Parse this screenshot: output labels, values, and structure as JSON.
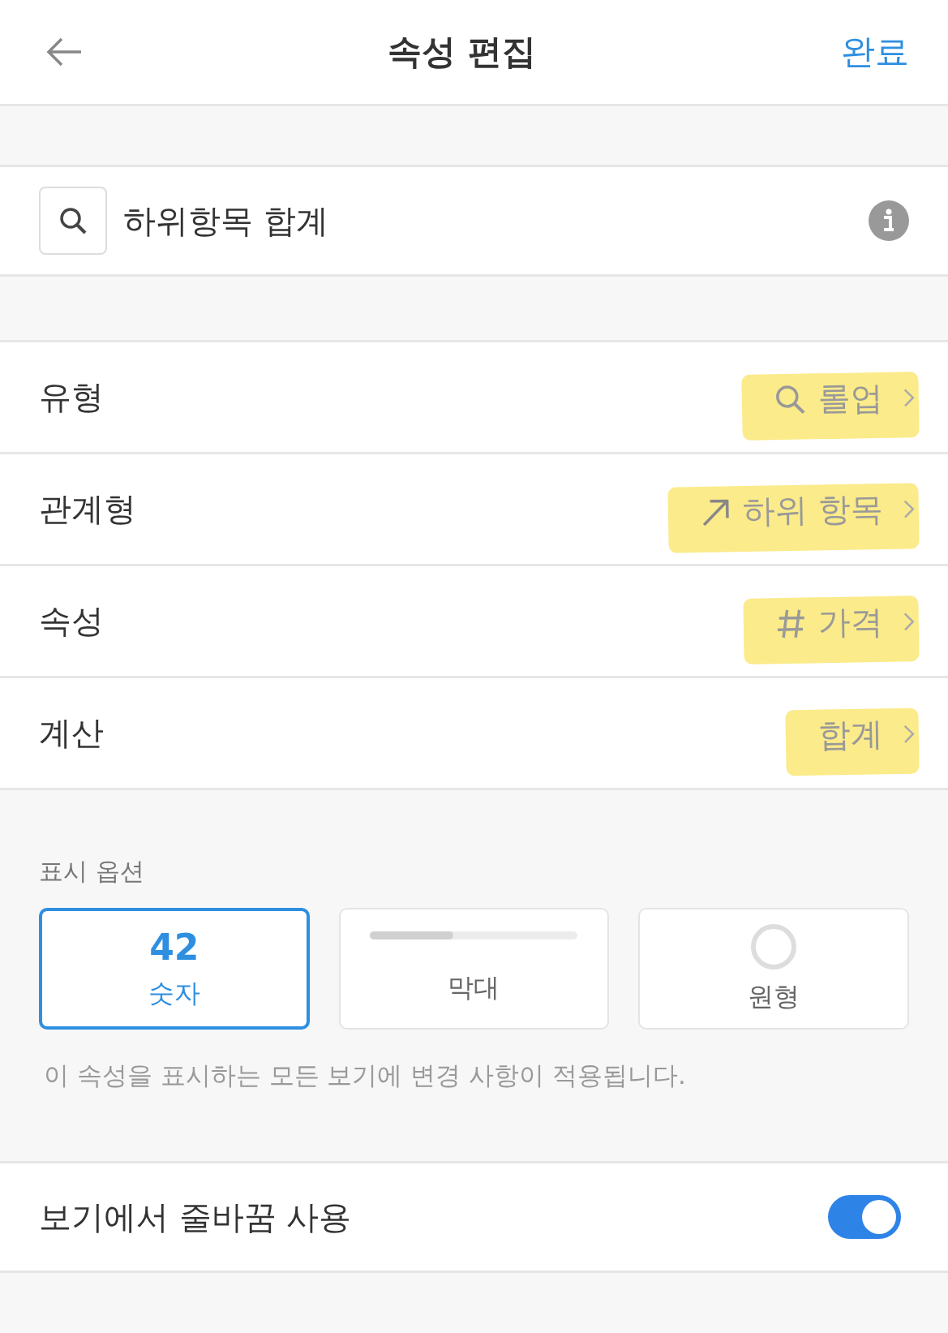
{
  "header": {
    "title": "속성 편집",
    "done": "완료"
  },
  "name_field": {
    "value": "하위항목 합계"
  },
  "rows": [
    {
      "label": "유형",
      "value": "롤업",
      "kind": "search",
      "highlighted": true
    },
    {
      "label": "관계형",
      "value": "하위 항목",
      "kind": "arrow",
      "highlighted": true
    },
    {
      "label": "속성",
      "value": "가격",
      "kind": "hash",
      "highlighted": true
    },
    {
      "label": "계산",
      "value": "합계",
      "kind": "plain",
      "highlighted": true
    }
  ],
  "display_options": {
    "title": "표시 옵션",
    "options": [
      {
        "kind": "number",
        "sample": "42",
        "label": "숫자",
        "selected": true
      },
      {
        "kind": "bar",
        "label": "막대",
        "level": 0.4,
        "selected": false
      },
      {
        "kind": "ring",
        "label": "원형",
        "selected": false
      }
    ],
    "note": "이 속성을 표시하는 모든 보기에 변경 사항이 적용됩니다."
  },
  "wrap_toggle": {
    "label": "보기에서 줄바꿈 사용",
    "on": true
  }
}
